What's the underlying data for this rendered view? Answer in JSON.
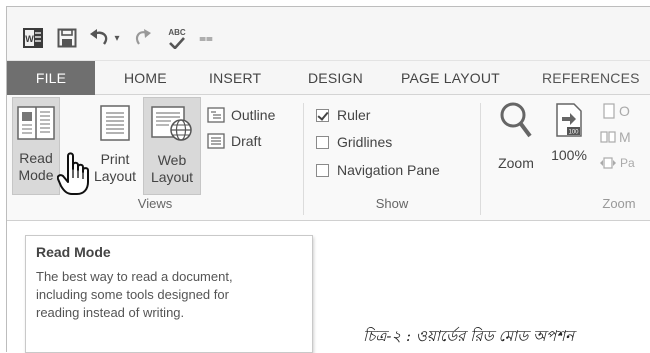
{
  "quick_access": {
    "icons": [
      "word-app-icon",
      "save-icon",
      "undo-icon",
      "redo-icon",
      "spelling-abc-icon",
      "customize-dropdown-icon"
    ],
    "spelling_label": "ABC",
    "undo_caret": "▾",
    "customize_glyph": "⩵"
  },
  "tabs": [
    {
      "label": "FILE",
      "active": true
    },
    {
      "label": "HOME"
    },
    {
      "label": "INSERT"
    },
    {
      "label": "DESIGN"
    },
    {
      "label": "PAGE LAYOUT"
    },
    {
      "label": "REFERENCES"
    }
  ],
  "ribbon": {
    "views": {
      "group_label": "Views",
      "read_mode": {
        "line1": "Read",
        "line2": "Mode"
      },
      "print_layout": {
        "line1": "Print",
        "line2": "Layout"
      },
      "web_layout": {
        "line1": "Web",
        "line2": "Layout"
      },
      "outline": "Outline",
      "draft": "Draft"
    },
    "show": {
      "group_label": "Show",
      "ruler": {
        "label": "Ruler",
        "checked": true
      },
      "gridlines": {
        "label": "Gridlines",
        "checked": false
      },
      "navigation_pane": {
        "label": "Navigation Pane",
        "checked": false
      }
    },
    "zoom": {
      "group_label": "Zoom",
      "zoom_label": "Zoom",
      "percent_label": "100%",
      "percent_icon_text": "100",
      "one_page_partial": "O",
      "multiple_pages_partial": "M",
      "page_width_partial": "Pa"
    }
  },
  "tooltip": {
    "title": "Read Mode",
    "line1": "The best way to read a document,",
    "line2": "including some tools designed for",
    "line3": "reading instead of writing."
  },
  "caption": "চিত্র-২ : ওয়ার্ডের রিড মোড অপশন",
  "colors": {
    "file_tab_bg": "#6f6f6f",
    "selected_button_bg": "#d9d9d9",
    "word_icon": "#2b579a"
  }
}
